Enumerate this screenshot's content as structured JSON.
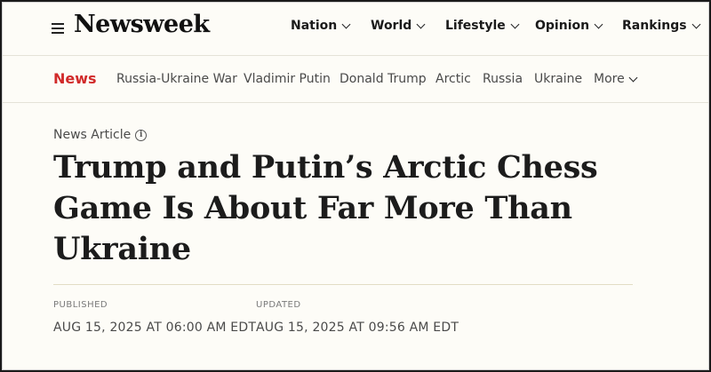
{
  "header": {
    "logo": "Newsweek",
    "nav": [
      {
        "label": "Nation"
      },
      {
        "label": "World"
      },
      {
        "label": "Lifestyle"
      },
      {
        "label": "Opinion"
      },
      {
        "label": "Rankings"
      }
    ]
  },
  "subnav": {
    "section": "News",
    "topics": [
      {
        "label": "Russia-Ukraine War"
      },
      {
        "label": "Vladimir Putin"
      },
      {
        "label": "Donald Trump"
      },
      {
        "label": "Arctic"
      },
      {
        "label": "Russia"
      },
      {
        "label": "Ukraine"
      }
    ],
    "more_label": "More"
  },
  "article": {
    "kicker": "News Article",
    "headline": "Trump and Putin’s Arctic Chess Game Is About Far More Than Ukraine",
    "published_label": "PUBLISHED",
    "published_value": "AUG 15, 2025 AT 06:00 AM EDT",
    "updated_label": "UPDATED",
    "updated_value": "AUG 15, 2025 AT 09:56 AM EDT"
  },
  "colors": {
    "section_red": "#d12a2a",
    "background": "#fdfcf7"
  },
  "icons": [
    "menu-icon",
    "chevron-down-icon",
    "info-icon"
  ]
}
